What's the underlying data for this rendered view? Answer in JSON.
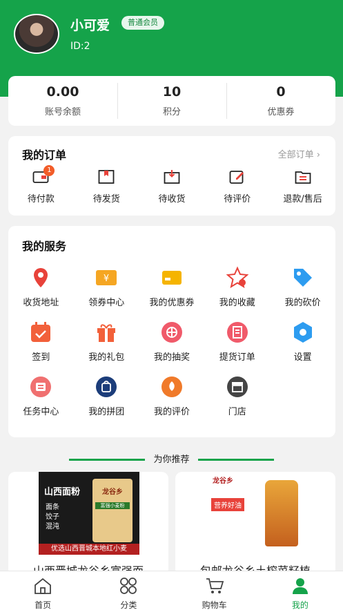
{
  "profile": {
    "name": "小可爱",
    "level": "普通会员",
    "id_text": "ID:2"
  },
  "stats": [
    {
      "value": "0.00",
      "label": "账号余额"
    },
    {
      "value": "10",
      "label": "积分"
    },
    {
      "value": "0",
      "label": "优惠券"
    }
  ],
  "orders": {
    "title": "我的订单",
    "more": "全部订单 ›",
    "items": [
      {
        "label": "待付款",
        "icon": "wallet-icon",
        "badge": "1"
      },
      {
        "label": "待发货",
        "icon": "package-icon"
      },
      {
        "label": "待收货",
        "icon": "inbox-icon"
      },
      {
        "label": "待评价",
        "icon": "edit-icon"
      },
      {
        "label": "退款/售后",
        "icon": "folder-icon"
      }
    ]
  },
  "services": {
    "title": "我的服务",
    "items": [
      {
        "label": "收货地址",
        "icon": "location-icon",
        "color": "#e8423a"
      },
      {
        "label": "领券中心",
        "icon": "coupon-icon",
        "color": "#f5a623"
      },
      {
        "label": "我的优惠券",
        "icon": "ticket-icon",
        "color": "#f5b400"
      },
      {
        "label": "我的收藏",
        "icon": "star-icon",
        "color": "#e8423a"
      },
      {
        "label": "我的砍价",
        "icon": "tag-icon",
        "color": "#2d9cf0"
      },
      {
        "label": "签到",
        "icon": "calendar-icon",
        "color": "#f2603a"
      },
      {
        "label": "我的礼包",
        "icon": "gift-icon",
        "color": "#f2603a"
      },
      {
        "label": "我的抽奖",
        "icon": "lottery-icon",
        "color": "#f05a6a"
      },
      {
        "label": "提货订单",
        "icon": "receipt-icon",
        "color": "#f05a6a"
      },
      {
        "label": "设置",
        "icon": "settings-icon",
        "color": "#2d9cf0"
      },
      {
        "label": "任务中心",
        "icon": "task-icon",
        "color": "#f07070"
      },
      {
        "label": "我的拼团",
        "icon": "group-icon",
        "color": "#1c3d7a"
      },
      {
        "label": "我的评价",
        "icon": "review-icon",
        "color": "#f07a2a"
      },
      {
        "label": "门店",
        "icon": "store-icon",
        "color": "#444444"
      }
    ]
  },
  "recommend": {
    "title": "为你推荐"
  },
  "products": [
    {
      "name": "山西晋城龙谷乡富强面",
      "banner": "山西面粉",
      "bullets": [
        "面条",
        "饺子",
        "混沌"
      ],
      "brand": "龙谷乡",
      "tag": "富强小麦粉",
      "caption": "优选山西晋城本地红小麦"
    },
    {
      "name": "包邮龙谷乡土榨菜籽植",
      "brand": "龙谷乡",
      "tag": "营养好油"
    }
  ],
  "tabbar": [
    {
      "label": "首页",
      "icon": "home-icon"
    },
    {
      "label": "分类",
      "icon": "category-icon"
    },
    {
      "label": "购物车",
      "icon": "cart-icon"
    },
    {
      "label": "我的",
      "icon": "user-icon",
      "active": true
    }
  ],
  "colors": {
    "brand": "#15a34a",
    "badge": "#f25c28"
  }
}
